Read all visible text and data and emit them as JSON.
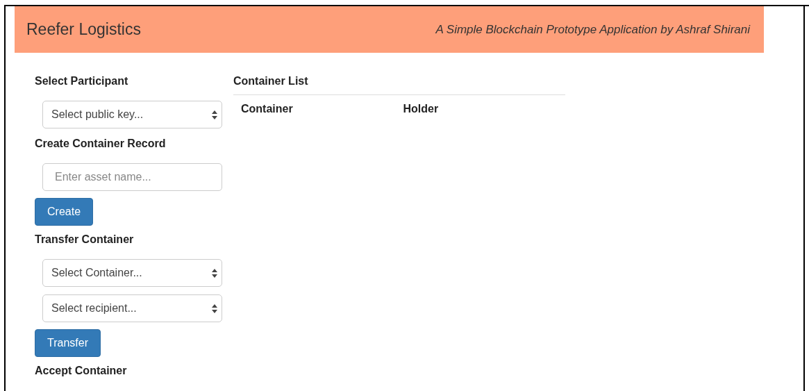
{
  "header": {
    "title": "Reefer Logistics",
    "subtitle": "A Simple Blockchain Prototype Application by Ashraf Shirani"
  },
  "sections": [
    {
      "heading": "Select Participant",
      "controls": [
        {
          "kind": "select",
          "placeholder": "Select public key..."
        }
      ]
    },
    {
      "heading": "Create Container Record",
      "controls": [
        {
          "kind": "input",
          "placeholder": "Enter asset name..."
        },
        {
          "kind": "button",
          "label": "Create"
        }
      ]
    },
    {
      "heading": "Transfer Container",
      "controls": [
        {
          "kind": "select",
          "placeholder": "Select Container..."
        },
        {
          "kind": "select",
          "placeholder": "Select recipient..."
        },
        {
          "kind": "button",
          "label": "Transfer"
        }
      ]
    },
    {
      "heading": "Accept Container"
    }
  ],
  "container_list": {
    "heading": "Container List",
    "columns": [
      "Container",
      "Holder"
    ]
  }
}
